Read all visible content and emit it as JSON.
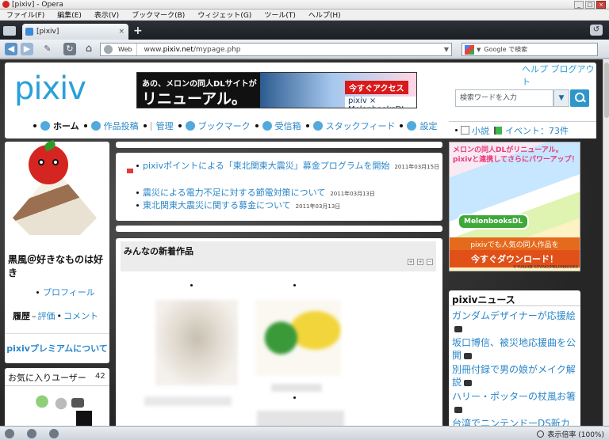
{
  "window": {
    "title": "[pixiv] - Opera"
  },
  "menu": [
    "ファイル(F)",
    "編集(E)",
    "表示(V)",
    "ブックマーク(B)",
    "ウィジェット(G)",
    "ツール(T)",
    "ヘルプ(H)"
  ],
  "tab": {
    "title": "[pixiv]"
  },
  "address": {
    "site_label": "Web",
    "url_prefix": "www.",
    "url_host": "pixiv.net",
    "url_path": "/mypage.php"
  },
  "browser_search": {
    "placeholder": "Google で検索"
  },
  "header": {
    "logo": "pixiv",
    "help_links": "ヘルプ ブログアウト",
    "search_placeholder": "検索ワードを入力",
    "ad": {
      "line1": "あの、メロンの同人DLサイトが",
      "line2": "リニューアル。",
      "cta": "今すぐアクセス",
      "brand": "pixiv × MelonbooksDL"
    },
    "nav": [
      {
        "label": "ホーム",
        "icon": "home-icon"
      },
      {
        "label": "作品投稿",
        "icon": "upload-icon"
      },
      {
        "label": "管理",
        "icon": ""
      },
      {
        "label": "ブックマーク",
        "icon": "star-icon"
      },
      {
        "label": "受信箱",
        "icon": "mail-icon"
      },
      {
        "label": "スタックフィード",
        "icon": "feed-icon"
      },
      {
        "label": "設定",
        "icon": "gear-icon"
      }
    ],
    "extra_nav": {
      "novel": "小説",
      "event": "イベント：73件"
    }
  },
  "profile": {
    "name": "黒風＠好きなものは好き",
    "profile_link": "プロフィール",
    "history_label": "履歴",
    "history_rating": "評価",
    "history_comment": "コメント",
    "premium": "pixivプレミアムについて"
  },
  "favorite_users": {
    "title": "お気に入りユーザー",
    "count": "42"
  },
  "news": [
    {
      "text": "pixivポイントによる「東北関東大震災」募金プログラムを開始",
      "date": "2011年03月15日"
    },
    {
      "text": "震災による電力不足に対する節電対策について",
      "date": "2011年03月13日"
    },
    {
      "text": "東北関東大震災に関する募金について",
      "date": "2011年03月13日"
    }
  ],
  "works": {
    "title": "みんなの新着作品"
  },
  "melon_ad": {
    "line1": "メロンの同人DLがリニューアル。",
    "line2": "pixivと連携してさらにパワーアップ！",
    "logo": "MelonbooksDL",
    "line3": "pixivでも人気の同人作品を",
    "cta": "今すぐダウンロード！",
    "credit": "©YUSUKE KITANO/MELONBOOKS"
  },
  "pixiv_news": {
    "title": "pixivニュース",
    "items": [
      "ガンダムデザイナーが応援絵",
      "坂口博信、被災地応援曲を公開",
      "別冊付録で男の娘がメイク解説",
      "ハリー・ポッターの杖風お箸",
      "台湾でニンテンドーDS新カラー"
    ]
  },
  "status": {
    "zoom": "表示倍率 (100%)"
  }
}
